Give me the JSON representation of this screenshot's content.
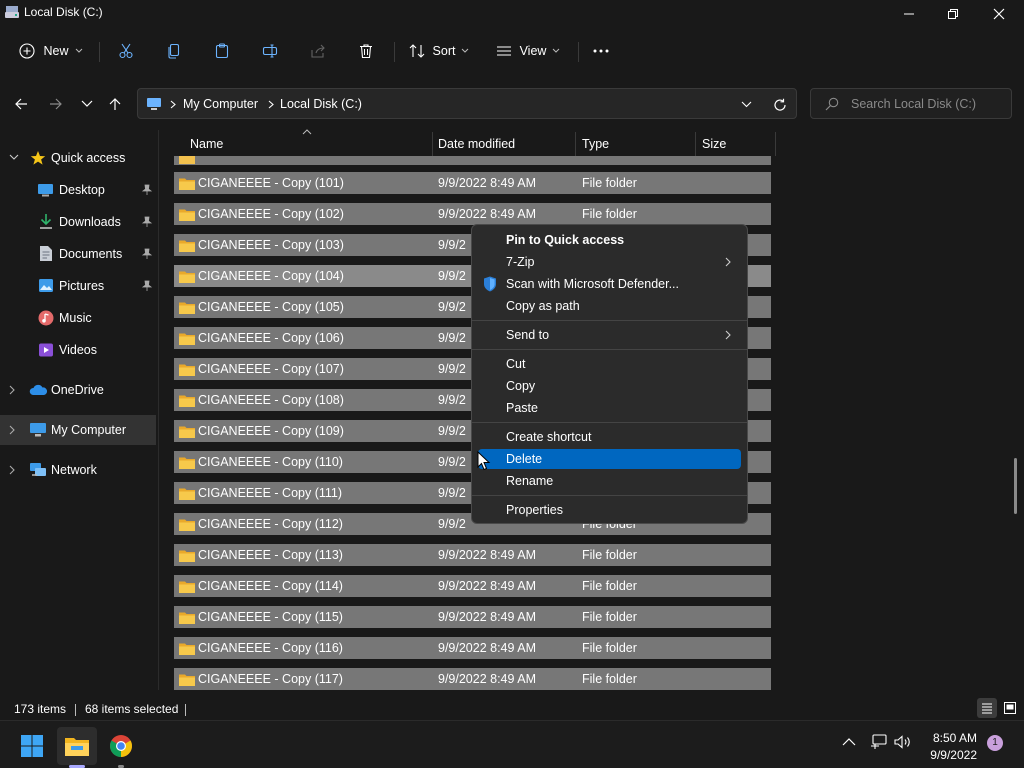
{
  "window": {
    "title": "Local Disk (C:)"
  },
  "toolbar": {
    "new_label": "New",
    "sort_label": "Sort",
    "view_label": "View"
  },
  "address": {
    "root": "My Computer",
    "current": "Local Disk (C:)"
  },
  "search": {
    "placeholder": "Search Local Disk (C:)"
  },
  "sidebar": {
    "items": [
      {
        "label": "Quick access"
      },
      {
        "label": "Desktop"
      },
      {
        "label": "Downloads"
      },
      {
        "label": "Documents"
      },
      {
        "label": "Pictures"
      },
      {
        "label": "Music"
      },
      {
        "label": "Videos"
      },
      {
        "label": "OneDrive"
      },
      {
        "label": "My Computer"
      },
      {
        "label": "Network"
      }
    ]
  },
  "columns": {
    "name": "Name",
    "date": "Date modified",
    "type": "Type",
    "size": "Size"
  },
  "files": [
    {
      "name": "CIGANEEEE - Copy (101)",
      "date": "9/9/2022 8:49 AM",
      "type": "File folder"
    },
    {
      "name": "CIGANEEEE - Copy (102)",
      "date": "9/9/2022 8:49 AM",
      "type": "File folder"
    },
    {
      "name": "CIGANEEEE - Copy (103)",
      "date": "9/9/2",
      "type": ""
    },
    {
      "name": "CIGANEEEE - Copy (104)",
      "date": "9/9/2",
      "type": ""
    },
    {
      "name": "CIGANEEEE - Copy (105)",
      "date": "9/9/2",
      "type": ""
    },
    {
      "name": "CIGANEEEE - Copy (106)",
      "date": "9/9/2",
      "type": ""
    },
    {
      "name": "CIGANEEEE - Copy (107)",
      "date": "9/9/2",
      "type": ""
    },
    {
      "name": "CIGANEEEE - Copy (108)",
      "date": "9/9/2",
      "type": ""
    },
    {
      "name": "CIGANEEEE - Copy (109)",
      "date": "9/9/2",
      "type": ""
    },
    {
      "name": "CIGANEEEE - Copy (110)",
      "date": "9/9/2",
      "type": ""
    },
    {
      "name": "CIGANEEEE - Copy (111)",
      "date": "9/9/2",
      "type": ""
    },
    {
      "name": "CIGANEEEE - Copy (112)",
      "date": "9/9/2",
      "type": "File folder"
    },
    {
      "name": "CIGANEEEE - Copy (113)",
      "date": "9/9/2022 8:49 AM",
      "type": "File folder"
    },
    {
      "name": "CIGANEEEE - Copy (114)",
      "date": "9/9/2022 8:49 AM",
      "type": "File folder"
    },
    {
      "name": "CIGANEEEE - Copy (115)",
      "date": "9/9/2022 8:49 AM",
      "type": "File folder"
    },
    {
      "name": "CIGANEEEE - Copy (116)",
      "date": "9/9/2022 8:49 AM",
      "type": "File folder"
    },
    {
      "name": "CIGANEEEE - Copy (117)",
      "date": "9/9/2022 8:49 AM",
      "type": "File folder"
    }
  ],
  "context_menu": {
    "pin": "Pin to Quick access",
    "zip": "7-Zip",
    "defender": "Scan with Microsoft Defender...",
    "copy_path": "Copy as path",
    "send_to": "Send to",
    "cut": "Cut",
    "copy": "Copy",
    "paste": "Paste",
    "shortcut": "Create shortcut",
    "delete": "Delete",
    "rename": "Rename",
    "properties": "Properties"
  },
  "status": {
    "count": "173 items",
    "selected": "68 items selected"
  },
  "taskbar": {
    "time": "8:50 AM",
    "date": "9/9/2022",
    "notifications": "1"
  },
  "colors": {
    "accent": "#0067c0",
    "row_selected": "#777777",
    "background": "#191919"
  }
}
